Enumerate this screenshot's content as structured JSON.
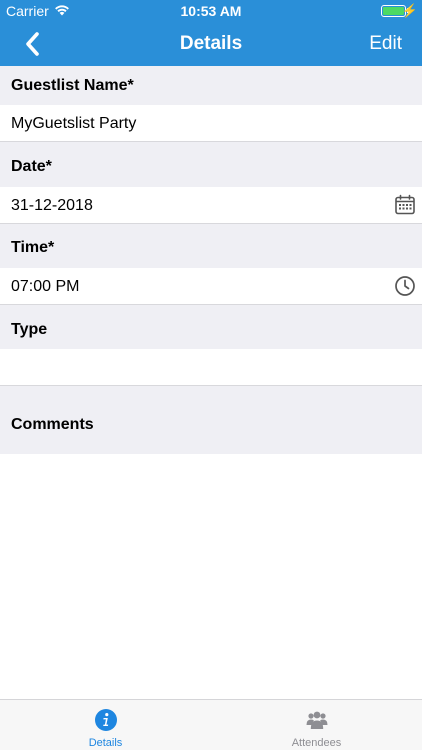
{
  "status_bar": {
    "carrier": "Carrier",
    "time": "10:53 AM",
    "charge": "⚡"
  },
  "nav": {
    "title": "Details",
    "edit_label": "Edit",
    "back_icon": "chevron-left-icon"
  },
  "form": {
    "guestlist_name": {
      "label": "Guestlist Name*",
      "value": "MyGuetslist Party"
    },
    "date": {
      "label": "Date*",
      "value": "31-12-2018",
      "icon": "calendar-icon"
    },
    "time": {
      "label": "Time*",
      "value": "07:00 PM",
      "icon": "clock-icon"
    },
    "type": {
      "label": "Type",
      "value": ""
    },
    "comments": {
      "label": "Comments"
    }
  },
  "tabs": [
    {
      "label": "Details",
      "icon": "info-icon",
      "active": true
    },
    {
      "label": "Attendees",
      "icon": "people-icon",
      "active": false
    }
  ],
  "colors": {
    "accent": "#2a8fd8",
    "tab_active": "#1e86e0",
    "tab_inactive": "#8e8e93",
    "section_bg": "#efeff4",
    "battery": "#4cd964"
  }
}
